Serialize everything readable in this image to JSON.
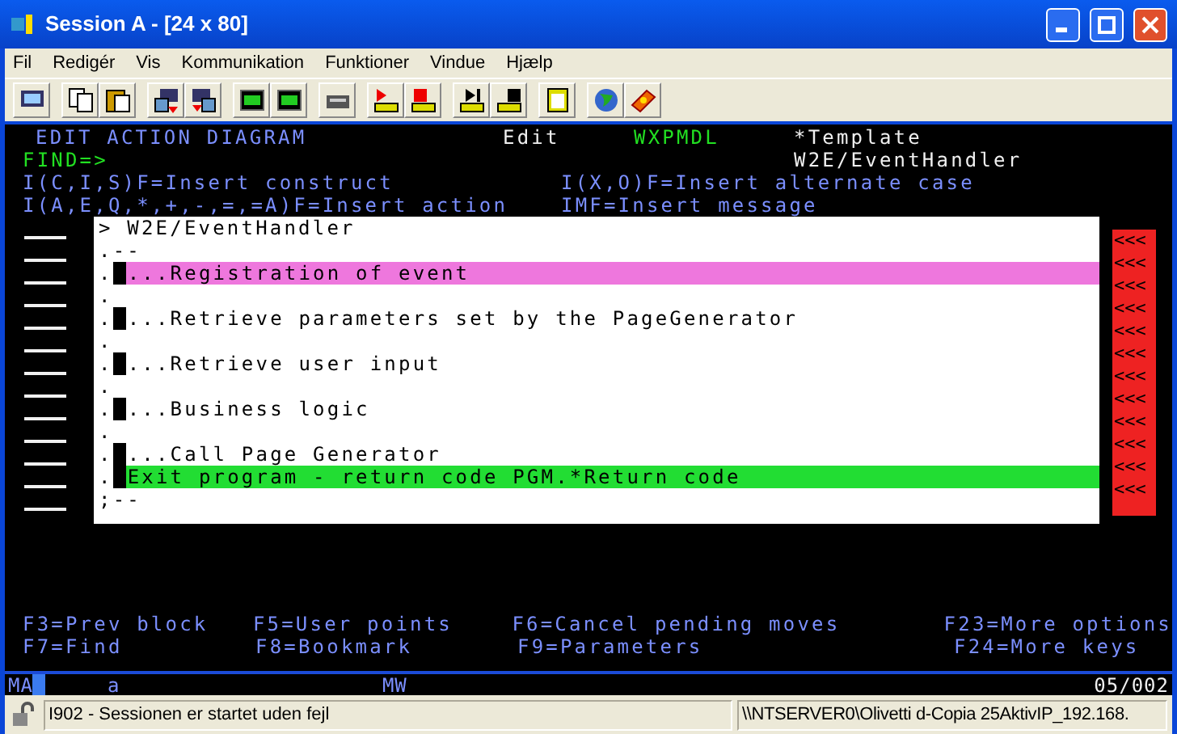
{
  "window": {
    "title": "Session A - [24 x 80]"
  },
  "menu": [
    "Fil",
    "Redigér",
    "Vis",
    "Kommunikation",
    "Funktioner",
    "Vindue",
    "Hjælp"
  ],
  "screen": {
    "header": {
      "title": "EDIT ACTION DIAGRAM",
      "mode": "Edit",
      "model": "WXPMDL",
      "template": "*Template"
    },
    "find_prompt": "FIND=>",
    "function_name": "W2E/EventHandler",
    "instructions": [
      "I(C,I,S)F=Insert construct",
      "I(X,O)F=Insert alternate case",
      "I(A,E,Q,*,+,-,=,=A)F=Insert action",
      "IMF=Insert message"
    ],
    "popup": {
      "title": "> W2E/EventHandler",
      "lines": [
        {
          "kind": "plain",
          "text": ".--"
        },
        {
          "kind": "action",
          "lead": ".",
          "text": "...Registration of event",
          "color": "#ee77dd"
        },
        {
          "kind": "plain",
          "text": "."
        },
        {
          "kind": "action",
          "lead": ".",
          "text": "...Retrieve parameters set by the PageGenerator"
        },
        {
          "kind": "plain",
          "text": "."
        },
        {
          "kind": "action",
          "lead": ".",
          "text": "...Retrieve user input"
        },
        {
          "kind": "plain",
          "text": "."
        },
        {
          "kind": "action",
          "lead": ".",
          "text": "...Business logic"
        },
        {
          "kind": "plain",
          "text": "."
        },
        {
          "kind": "action",
          "lead": ".",
          "text": "...Call Page Generator"
        },
        {
          "kind": "action",
          "lead": ".",
          "text": "Exit program - return code PGM.*Return code",
          "color": "#22dd33"
        },
        {
          "kind": "plain",
          "text": ";--"
        }
      ]
    },
    "scroll_markers": [
      "<<<",
      "<<<",
      "<<<",
      "<<<",
      "<<<",
      "<<<",
      "<<<",
      "<<<",
      "<<<",
      "<<<",
      "<<<",
      "<<<"
    ],
    "function_keys": [
      [
        "F3=Prev block",
        "F5=User points",
        "F6=Cancel pending moves",
        "F23=More options"
      ],
      [
        "F7=Find",
        "F8=Bookmark",
        "F9=Parameters",
        "F24=More keys"
      ]
    ]
  },
  "status_line": {
    "mode": "MA",
    "input": "a",
    "indicator": "MW",
    "position": "05/002"
  },
  "status_bar": {
    "message": "I902 - Sessionen er startet uden fejl",
    "printer": "\\\\NTSERVER0\\Olivetti d-Copia 25AktivIP_192.168."
  }
}
